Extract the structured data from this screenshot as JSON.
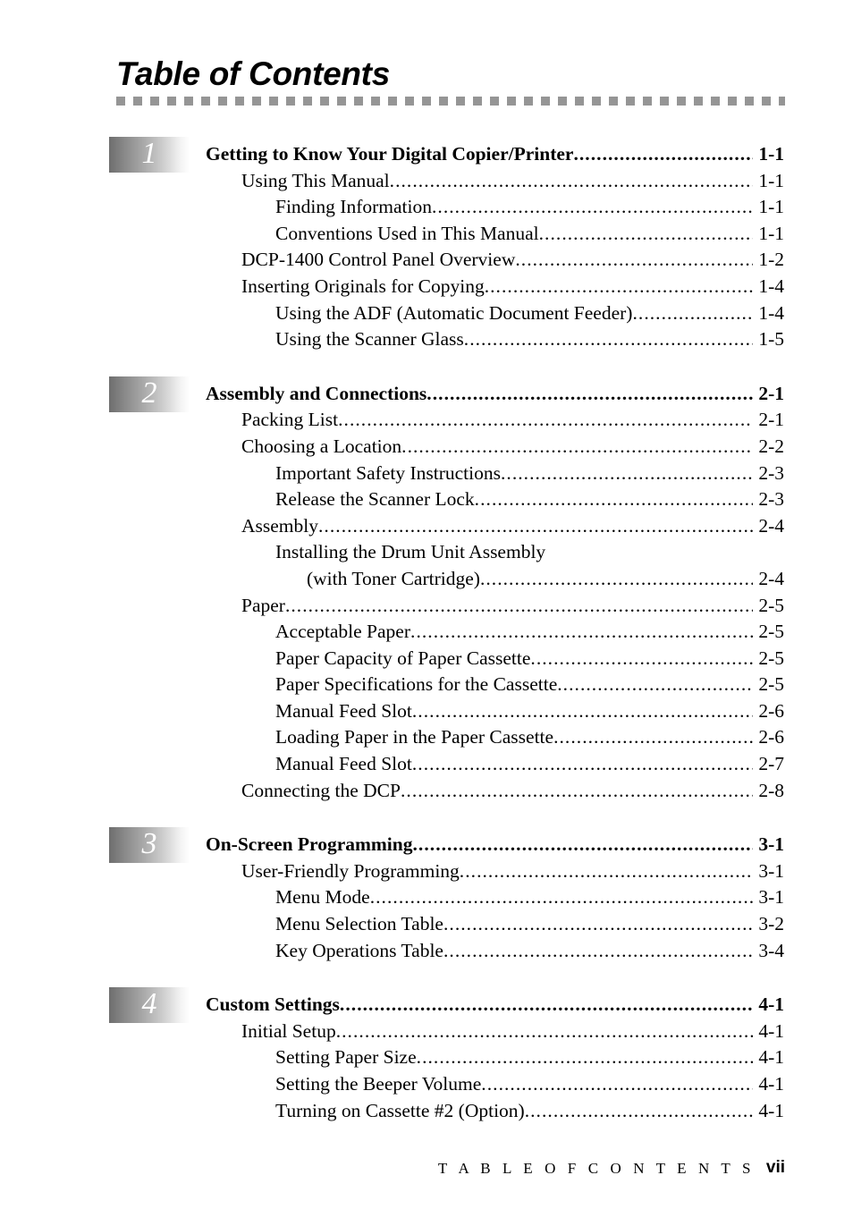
{
  "document": {
    "title": "Table of Contents"
  },
  "footer": {
    "label": "T A B L E   O F   C O N T E N T S",
    "page_number": "vii"
  },
  "dot_leader": "...........................................................................................................................................",
  "chapters": [
    {
      "number": "1",
      "title": "Getting to Know Your Digital Copier/Printer",
      "page": "1-1",
      "entries": [
        {
          "level": 1,
          "label": "Using This Manual",
          "page": "1-1"
        },
        {
          "level": 2,
          "label": " Finding Information",
          "page": "1-1"
        },
        {
          "level": 2,
          "label": "Conventions Used in This Manual ",
          "page": "1-1"
        },
        {
          "level": 1,
          "label": "DCP-1400 Control Panel Overview",
          "page": "1-2"
        },
        {
          "level": 1,
          "label": "Inserting Originals for Copying ",
          "page": "1-4"
        },
        {
          "level": 2,
          "label": "Using the ADF (Automatic Document Feeder)",
          "page": "1-4"
        },
        {
          "level": 2,
          "label": "Using the Scanner Glass",
          "page": "1-5"
        }
      ]
    },
    {
      "number": "2",
      "title": "Assembly and Connections",
      "page": "2-1",
      "entries": [
        {
          "level": 1,
          "label": "Packing List",
          "page": "2-1"
        },
        {
          "level": 1,
          "label": "Choosing a Location",
          "page": "2-2"
        },
        {
          "level": 2,
          "label": "Important Safety Instructions ",
          "page": "2-3"
        },
        {
          "level": 2,
          "label": "Release the Scanner Lock",
          "page": "2-3"
        },
        {
          "level": 1,
          "label": "Assembly",
          "page": "2-4"
        },
        {
          "level": 2,
          "label": "Installing the Drum Unit Assembly",
          "page": "",
          "no_leader": true
        },
        {
          "level": 3,
          "label": "(with Toner Cartridge) ",
          "page": "2-4"
        },
        {
          "level": 1,
          "label": "Paper",
          "page": "2-5"
        },
        {
          "level": 2,
          "label": "Acceptable Paper  ",
          "page": "2-5"
        },
        {
          "level": 2,
          "label": "Paper Capacity of Paper Cassette ",
          "page": "2-5"
        },
        {
          "level": 2,
          "label": "Paper Specifications for the Cassette ",
          "page": "2-5"
        },
        {
          "level": 2,
          "label": "Manual Feed Slot",
          "page": "2-6"
        },
        {
          "level": 2,
          "label": "Loading Paper in the Paper Cassette ",
          "page": "2-6"
        },
        {
          "level": 2,
          "label": "Manual Feed Slot",
          "page": "2-7"
        },
        {
          "level": 1,
          "label": "Connecting the DCP",
          "page": "2-8"
        }
      ]
    },
    {
      "number": "3",
      "title": "On-Screen Programming ",
      "page": "3-1",
      "entries": [
        {
          "level": 1,
          "label": "User-Friendly Programming ",
          "page": "3-1"
        },
        {
          "level": 2,
          "label": "Menu Mode ",
          "page": "3-1"
        },
        {
          "level": 2,
          "label": "Menu Selection Table",
          "page": "3-2"
        },
        {
          "level": 2,
          "label": "Key Operations Table",
          "page": "3-4"
        }
      ]
    },
    {
      "number": "4",
      "title": "Custom Settings",
      "page": "4-1",
      "entries": [
        {
          "level": 1,
          "label": "Initial Setup ",
          "page": "4-1"
        },
        {
          "level": 2,
          "label": "Setting Paper Size ",
          "page": "4-1"
        },
        {
          "level": 2,
          "label": "Setting the Beeper Volume",
          "page": "4-1"
        },
        {
          "level": 2,
          "label": "Turning on Cassette #2 (Option)",
          "page": "4-1"
        }
      ]
    }
  ]
}
